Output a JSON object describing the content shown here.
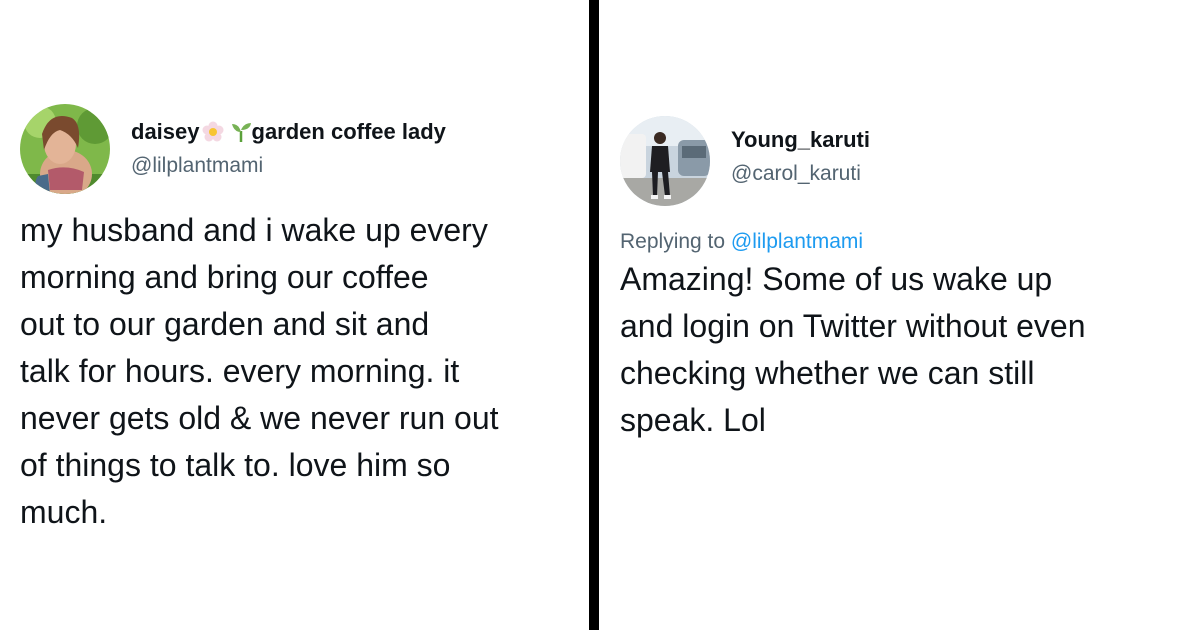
{
  "left_tweet": {
    "display_name_prefix": "daisey",
    "display_name_suffix": "garden coffee lady",
    "name_emojis": [
      "blossom-emoji",
      "seedling-emoji"
    ],
    "handle": "@lilplantmami",
    "text_lines": [
      "my husband and i wake up every",
      "morning and bring our coffee",
      "out to our garden and sit and",
      "talk for hours. every morning. it",
      "never gets old & we never run out",
      "of things to talk to. love him so",
      "much."
    ]
  },
  "right_tweet": {
    "display_name": "Young_karuti",
    "handle": "@carol_karuti",
    "replying_to_label": "Replying to",
    "replying_to_handle": "@lilplantmami",
    "text_lines": [
      "Amazing! Some of us wake up",
      "and login on Twitter without even",
      "checking whether we can still",
      "speak. Lol"
    ]
  },
  "colors": {
    "text_primary": "#0f1419",
    "text_secondary": "#536471",
    "link": "#1d9bf0",
    "divider": "#000000"
  }
}
